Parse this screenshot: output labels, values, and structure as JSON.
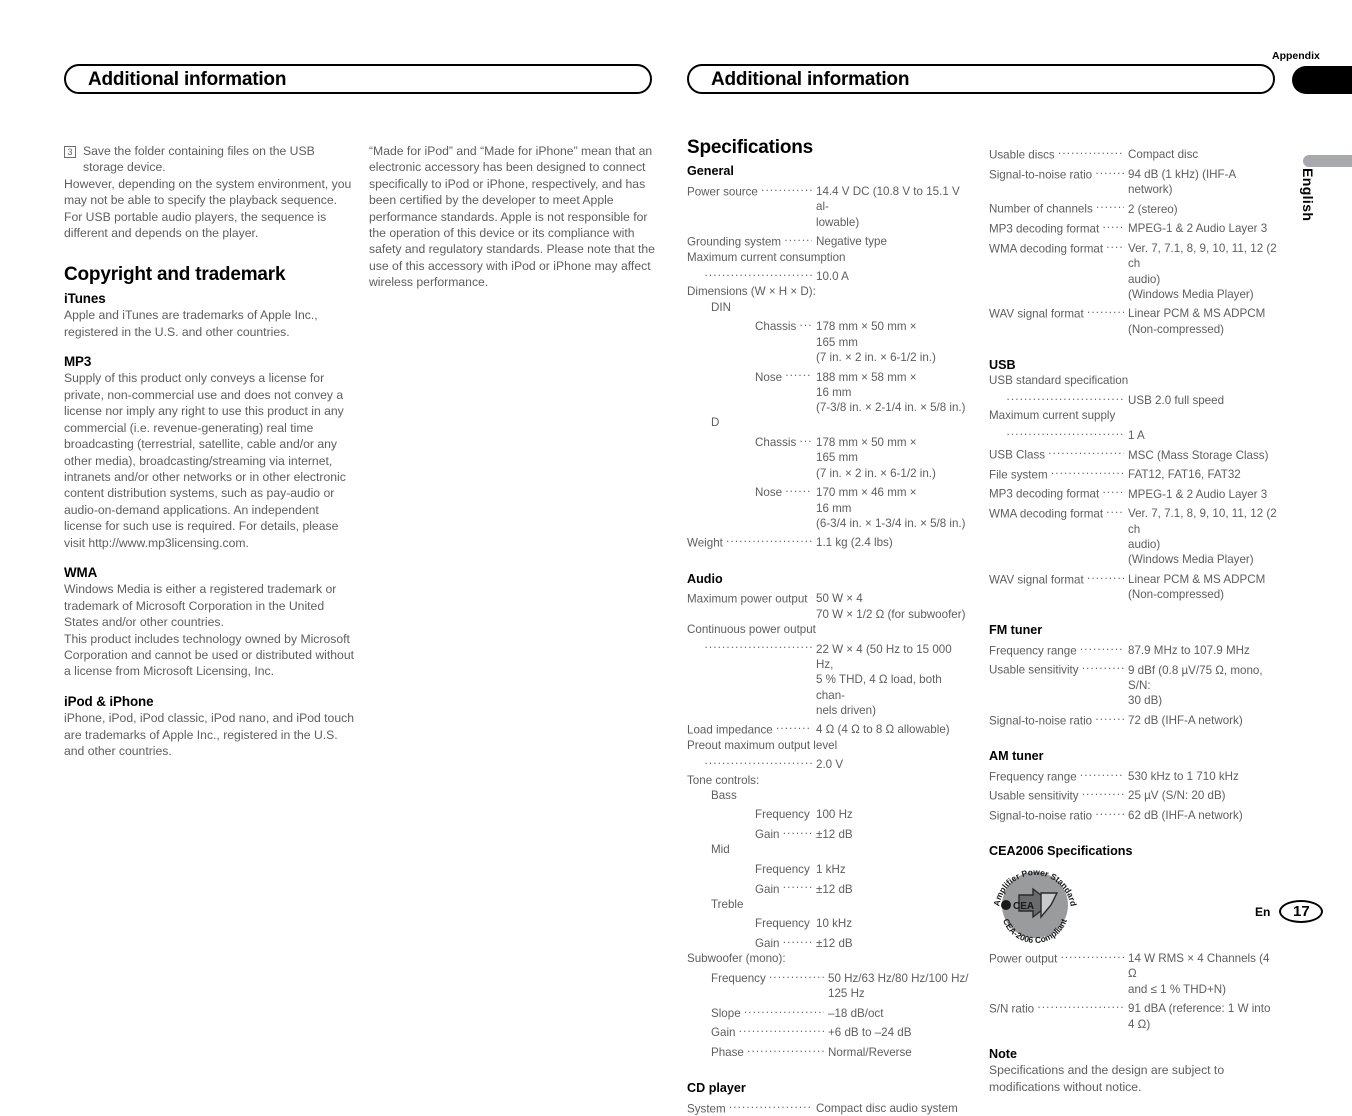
{
  "document": {
    "header_left": "Additional information",
    "header_right": "Additional information",
    "appendix_label": "Appendix",
    "side_language": "English",
    "footer_language": "En",
    "page_number": "17",
    "colors": {
      "body_text": "#5d5e60",
      "heading": "#000000",
      "tab_black": "#000000",
      "tab_gray": "#a7a9ac"
    }
  },
  "column_1": {
    "step": {
      "number": "3",
      "line1": "Save the folder containing files on the USB",
      "line2": "storage device."
    },
    "paragraph_1": "However, depending on the system environment, you may not be able to specify the playback sequence.",
    "paragraph_2": "For USB portable audio players, the sequence is different and depends on the player.",
    "section_title": "Copyright and trademark",
    "subsections": [
      {
        "title": "iTunes",
        "body": "Apple and iTunes are trademarks of Apple Inc., registered in the U.S. and other countries."
      },
      {
        "title": "MP3",
        "body": "Supply of this product only conveys a license for private, non-commercial use and does not convey a license nor imply any right to use this product in any commercial (i.e. revenue-generating) real time broadcasting (terrestrial, satellite, cable and/or any other media), broadcasting/streaming via internet, intranets and/or other networks or in other electronic content distribution systems, such as pay-audio or audio-on-demand applications. An independent license for such use is required. For details, please visit http://www.mp3licensing.com."
      },
      {
        "title": "WMA",
        "body": "Windows Media is either a registered trademark or trademark of Microsoft Corporation in the United States and/or other countries.",
        "body2": "This product includes technology owned by Microsoft Corporation and cannot be used or distributed without a license from Microsoft Licensing, Inc."
      },
      {
        "title": "iPod & iPhone",
        "body": "iPhone, iPod, iPod classic, iPod nano, and iPod touch are trademarks of Apple Inc., registered in the U.S. and other countries."
      }
    ]
  },
  "column_2": {
    "paragraph_1": "“Made for iPod” and “Made for iPhone” mean that an electronic accessory has been designed to connect specifically to iPod or iPhone, respectively, and has been certified by the developer to meet Apple performance standards. Apple is not responsible for the operation of this device or its compliance with safety and regulatory standards. Please note that the use of this accessory with iPod or iPhone may affect wireless performance."
  },
  "column_3": {
    "section_title": "Specifications",
    "general": {
      "title": "General",
      "power_source_label": "Power source",
      "power_source_value_1": "14.4 V DC (10.8 V to 15.1 V al-",
      "power_source_value_2": "lowable)",
      "grounding_label": "Grounding system",
      "grounding_value": "Negative type",
      "max_current_label": "Maximum current consumption",
      "max_current_value": "10.0 A",
      "dimensions_label": "Dimensions (W × H × D):",
      "din_label": "DIN",
      "din_chassis_label": "Chassis",
      "din_chassis_l1": "178 mm × 50 mm ×",
      "din_chassis_l2": "165 mm",
      "din_chassis_l3": "(7 in. × 2 in. × 6-1/2 in.)",
      "din_nose_label": "Nose",
      "din_nose_l1": "188 mm × 58 mm ×",
      "din_nose_l2": "16 mm",
      "din_nose_l3": "(7-3/8 in. × 2-1/4 in. × 5/8 in.)",
      "d_label": "D",
      "d_chassis_label": "Chassis",
      "d_chassis_l1": "178 mm × 50 mm ×",
      "d_chassis_l2": "165 mm",
      "d_chassis_l3": "(7 in. × 2 in. × 6-1/2 in.)",
      "d_nose_label": "Nose",
      "d_nose_l1": "170 mm × 46 mm ×",
      "d_nose_l2": "16 mm",
      "d_nose_l3": "(6-3/4 in. × 1-3/4 in. × 5/8 in.)",
      "weight_label": "Weight",
      "weight_value": "1.1 kg (2.4 lbs)"
    },
    "audio": {
      "title": "Audio",
      "max_power_label": "Maximum power output",
      "max_power_l1": "50 W × 4",
      "max_power_l2": "70 W × 1/2 Ω (for subwoofer)",
      "cont_power_label": "Continuous power output",
      "cont_power_l1": "22 W × 4 (50 Hz to 15 000 Hz,",
      "cont_power_l2": "5 % THD, 4 Ω load, both chan-",
      "cont_power_l3": "nels driven)",
      "load_imp_label": "Load impedance",
      "load_imp_value": "4 Ω (4 Ω to 8 Ω allowable)",
      "preout_label": "Preout maximum output level",
      "preout_value": "2.0 V",
      "tone_label": "Tone controls:",
      "bass_label": "Bass",
      "bass_freq_label": "Frequency",
      "bass_freq_value": "100 Hz",
      "bass_gain_label": "Gain",
      "bass_gain_value": "±12 dB",
      "mid_label": "Mid",
      "mid_freq_label": "Frequency",
      "mid_freq_value": "1 kHz",
      "mid_gain_label": "Gain",
      "mid_gain_value": "±12 dB",
      "treble_label": "Treble",
      "treble_freq_label": "Frequency",
      "treble_freq_value": "10 kHz",
      "treble_gain_label": "Gain",
      "treble_gain_value": "±12 dB",
      "subwoofer_label": "Subwoofer (mono):",
      "sub_freq_label": "Frequency",
      "sub_freq_l1": "50 Hz/63 Hz/80 Hz/100 Hz/",
      "sub_freq_l2": "125 Hz",
      "sub_slope_label": "Slope",
      "sub_slope_value": "–18 dB/oct",
      "sub_gain_label": "Gain",
      "sub_gain_value": "+6 dB to –24 dB",
      "sub_phase_label": "Phase",
      "sub_phase_value": "Normal/Reverse"
    },
    "cd_player": {
      "title": "CD player",
      "system_label": "System",
      "system_value": "Compact disc audio system"
    }
  },
  "column_4": {
    "cd_player_cont": {
      "usable_discs_label": "Usable discs",
      "usable_discs_value": "Compact disc",
      "snr_label": "Signal-to-noise ratio",
      "snr_value": "94 dB (1 kHz) (IHF-A network)",
      "channels_label": "Number of channels",
      "channels_value": "2 (stereo)",
      "mp3_label": "MP3 decoding format",
      "mp3_value": "MPEG-1 & 2 Audio Layer 3",
      "wma_label": "WMA decoding format",
      "wma_l1": "Ver. 7, 7.1, 8, 9, 10, 11, 12 (2 ch",
      "wma_l2": "audio)",
      "wma_l3": "(Windows Media Player)",
      "wav_label": "WAV signal format",
      "wav_l1": "Linear PCM & MS ADPCM",
      "wav_l2": "(Non-compressed)"
    },
    "usb": {
      "title": "USB",
      "std_label": "USB standard specification",
      "std_value": "USB 2.0 full speed",
      "max_current_label": "Maximum current supply",
      "max_current_value": "1 A",
      "class_label": "USB Class",
      "class_value": "MSC (Mass Storage Class)",
      "fs_label": "File system",
      "fs_value": "FAT12, FAT16, FAT32",
      "mp3_label": "MP3 decoding format",
      "mp3_value": "MPEG-1 & 2 Audio Layer 3",
      "wma_label": "WMA decoding format",
      "wma_l1": "Ver. 7, 7.1, 8, 9, 10, 11, 12 (2 ch",
      "wma_l2": "audio)",
      "wma_l3": "(Windows Media Player)",
      "wav_label": "WAV signal format",
      "wav_l1": "Linear PCM & MS ADPCM",
      "wav_l2": "(Non-compressed)"
    },
    "fm_tuner": {
      "title": "FM tuner",
      "freq_label": "Frequency range",
      "freq_value": "87.9 MHz to 107.9 MHz",
      "sens_label": "Usable sensitivity",
      "sens_l1": "9 dBf (0.8 µV/75 Ω, mono, S/N:",
      "sens_l2": "30 dB)",
      "snr_label": "Signal-to-noise ratio",
      "snr_value": "72 dB (IHF-A network)"
    },
    "am_tuner": {
      "title": "AM tuner",
      "freq_label": "Frequency range",
      "freq_value": "530 kHz to 1 710 kHz",
      "sens_label": "Usable sensitivity",
      "sens_value": "25 µV (S/N: 20 dB)",
      "snr_label": "Signal-to-noise ratio",
      "snr_value": "62 dB (IHF-A network)"
    },
    "cea2006": {
      "title": "CEA2006 Specifications",
      "logo_top_text": "Amplifier Power Standard",
      "logo_bottom_text": "CEA-2006 Compliant",
      "logo_center_text": "CEA",
      "power_label": "Power output",
      "power_l1": "14 W RMS × 4 Channels (4 Ω",
      "power_l2": "and ≤ 1 % THD+N)",
      "snr_label": "S/N ratio",
      "snr_l1": "91 dBA (reference: 1 W into",
      "snr_l2": "4 Ω)"
    },
    "note": {
      "title": "Note",
      "body": "Specifications and the design are subject to modifications without notice."
    }
  }
}
